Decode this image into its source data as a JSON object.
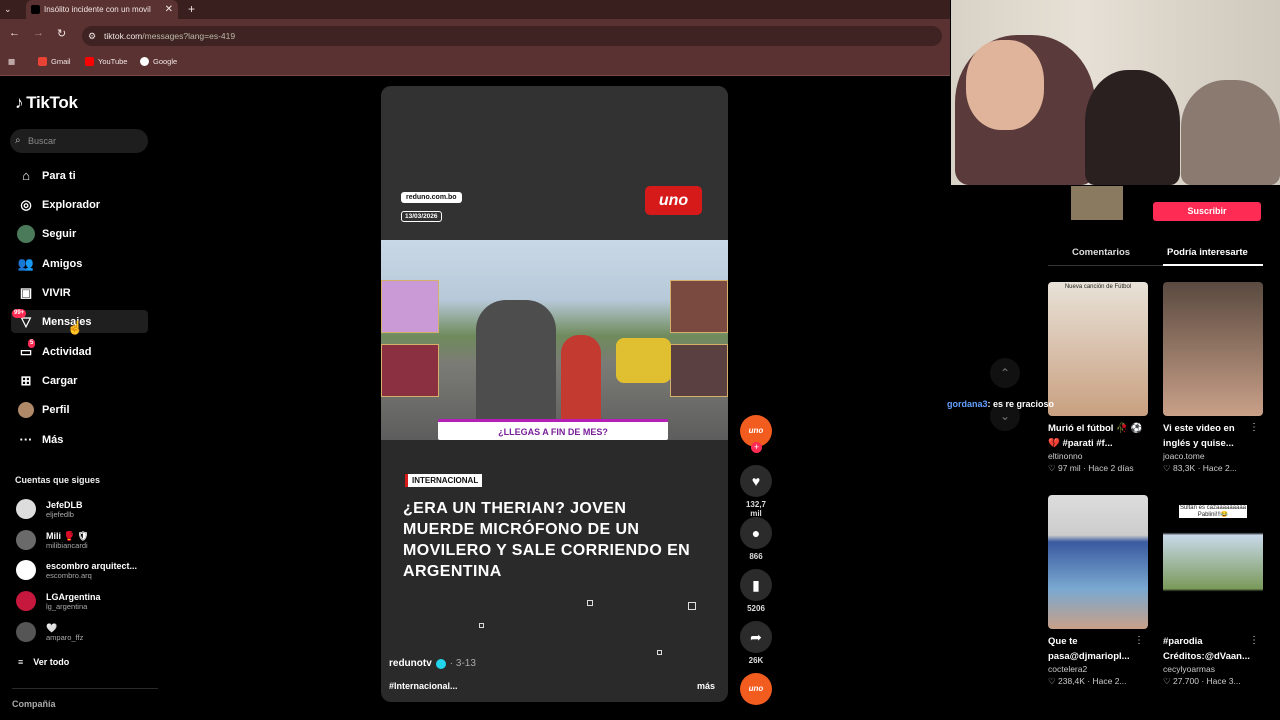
{
  "browser": {
    "tab_title": "Insólito incidente con un movil",
    "url_host": "tiktok.com",
    "url_path": "/messages?lang=es-419",
    "bookmarks": [
      {
        "label": "Gmail",
        "color": "#ea4335"
      },
      {
        "label": "YouTube",
        "color": "#ff0000"
      },
      {
        "label": "Google",
        "color": "#4285f4"
      }
    ]
  },
  "sidebar": {
    "logo": "TikTok",
    "search_placeholder": "Buscar",
    "nav": [
      {
        "label": "Para ti",
        "icon": "home-icon"
      },
      {
        "label": "Explorador",
        "icon": "compass-icon"
      },
      {
        "label": "Seguir",
        "icon": "following-icon"
      },
      {
        "label": "Amigos",
        "icon": "friends-icon"
      },
      {
        "label": "VIVIR",
        "icon": "live-icon"
      },
      {
        "label": "Mensajes",
        "icon": "messages-icon",
        "badge": "99+"
      },
      {
        "label": "Actividad",
        "icon": "activity-icon",
        "badge": "5"
      },
      {
        "label": "Cargar",
        "icon": "upload-icon"
      },
      {
        "label": "Perfil",
        "icon": "profile-icon"
      },
      {
        "label": "Más",
        "icon": "more-icon"
      }
    ],
    "following_title": "Cuentas que sigues",
    "following": [
      {
        "name": "JefeDLB",
        "handle": "eljefedlb"
      },
      {
        "name": "Mili 🥊 🛡",
        "handle": "milibiancardi"
      },
      {
        "name": "escombro arquitect...",
        "handle": "escombro.arq"
      },
      {
        "name": "LGArgentina",
        "handle": "lg_argentina"
      },
      {
        "name": "🤍",
        "handle": "amparo_ffz"
      }
    ],
    "see_all": "Ver todo",
    "company": "Compañía"
  },
  "video": {
    "source_label": "reduno.com.bo",
    "source_date": "13/03/2026",
    "channel_logo": "uno",
    "channel_logo_small": "red",
    "ticker": "¿LLEGAS A FIN DE MES?",
    "category": "INTERNACIONAL",
    "headline": "¿ERA UN THERIAN? JOVEN MUERDE MICRÓFONO DE UN MOVILERO Y SALE CORRIENDO EN ARGENTINA",
    "author": "redunotv",
    "date": "· 3-13",
    "caption": "#Internacional...",
    "more": "más"
  },
  "actions": {
    "avatar_label": "uno",
    "likes": "132,7 mil",
    "comments": "866",
    "saves": "5206",
    "shares": "26K"
  },
  "chat": {
    "user": "gordana3",
    "message": ": es re gracioso"
  },
  "right_panel": {
    "subscribe": "Suscribir",
    "tabs": [
      "Comentarios",
      "Podría interesarte"
    ],
    "cards": [
      {
        "title": "Murió el fútbol 🥀 ⚽ 💔 #parati #f...",
        "author": "eltinonno",
        "likes": "97 mil",
        "time": "Hace 2 días",
        "thumb_text": "Nueva canción de Fútbol"
      },
      {
        "title": "Vi este video en inglés y quise...",
        "author": "joaco.tome",
        "likes": "83,3K",
        "time": "Hace 2...",
        "thumb_text": ""
      },
      {
        "title": "Que te pasa@djmariopl...",
        "author": "coctelera2",
        "likes": "238,4K",
        "time": "Hace 2...",
        "thumb_text": ""
      },
      {
        "title": "#parodia Créditos:@dVaan...",
        "author": "cecylyoarmas",
        "likes": "27.700",
        "time": "Hace 3...",
        "thumb_text": "Sultan es cazaaaaaaaaa Pablini!!!😂"
      }
    ]
  }
}
